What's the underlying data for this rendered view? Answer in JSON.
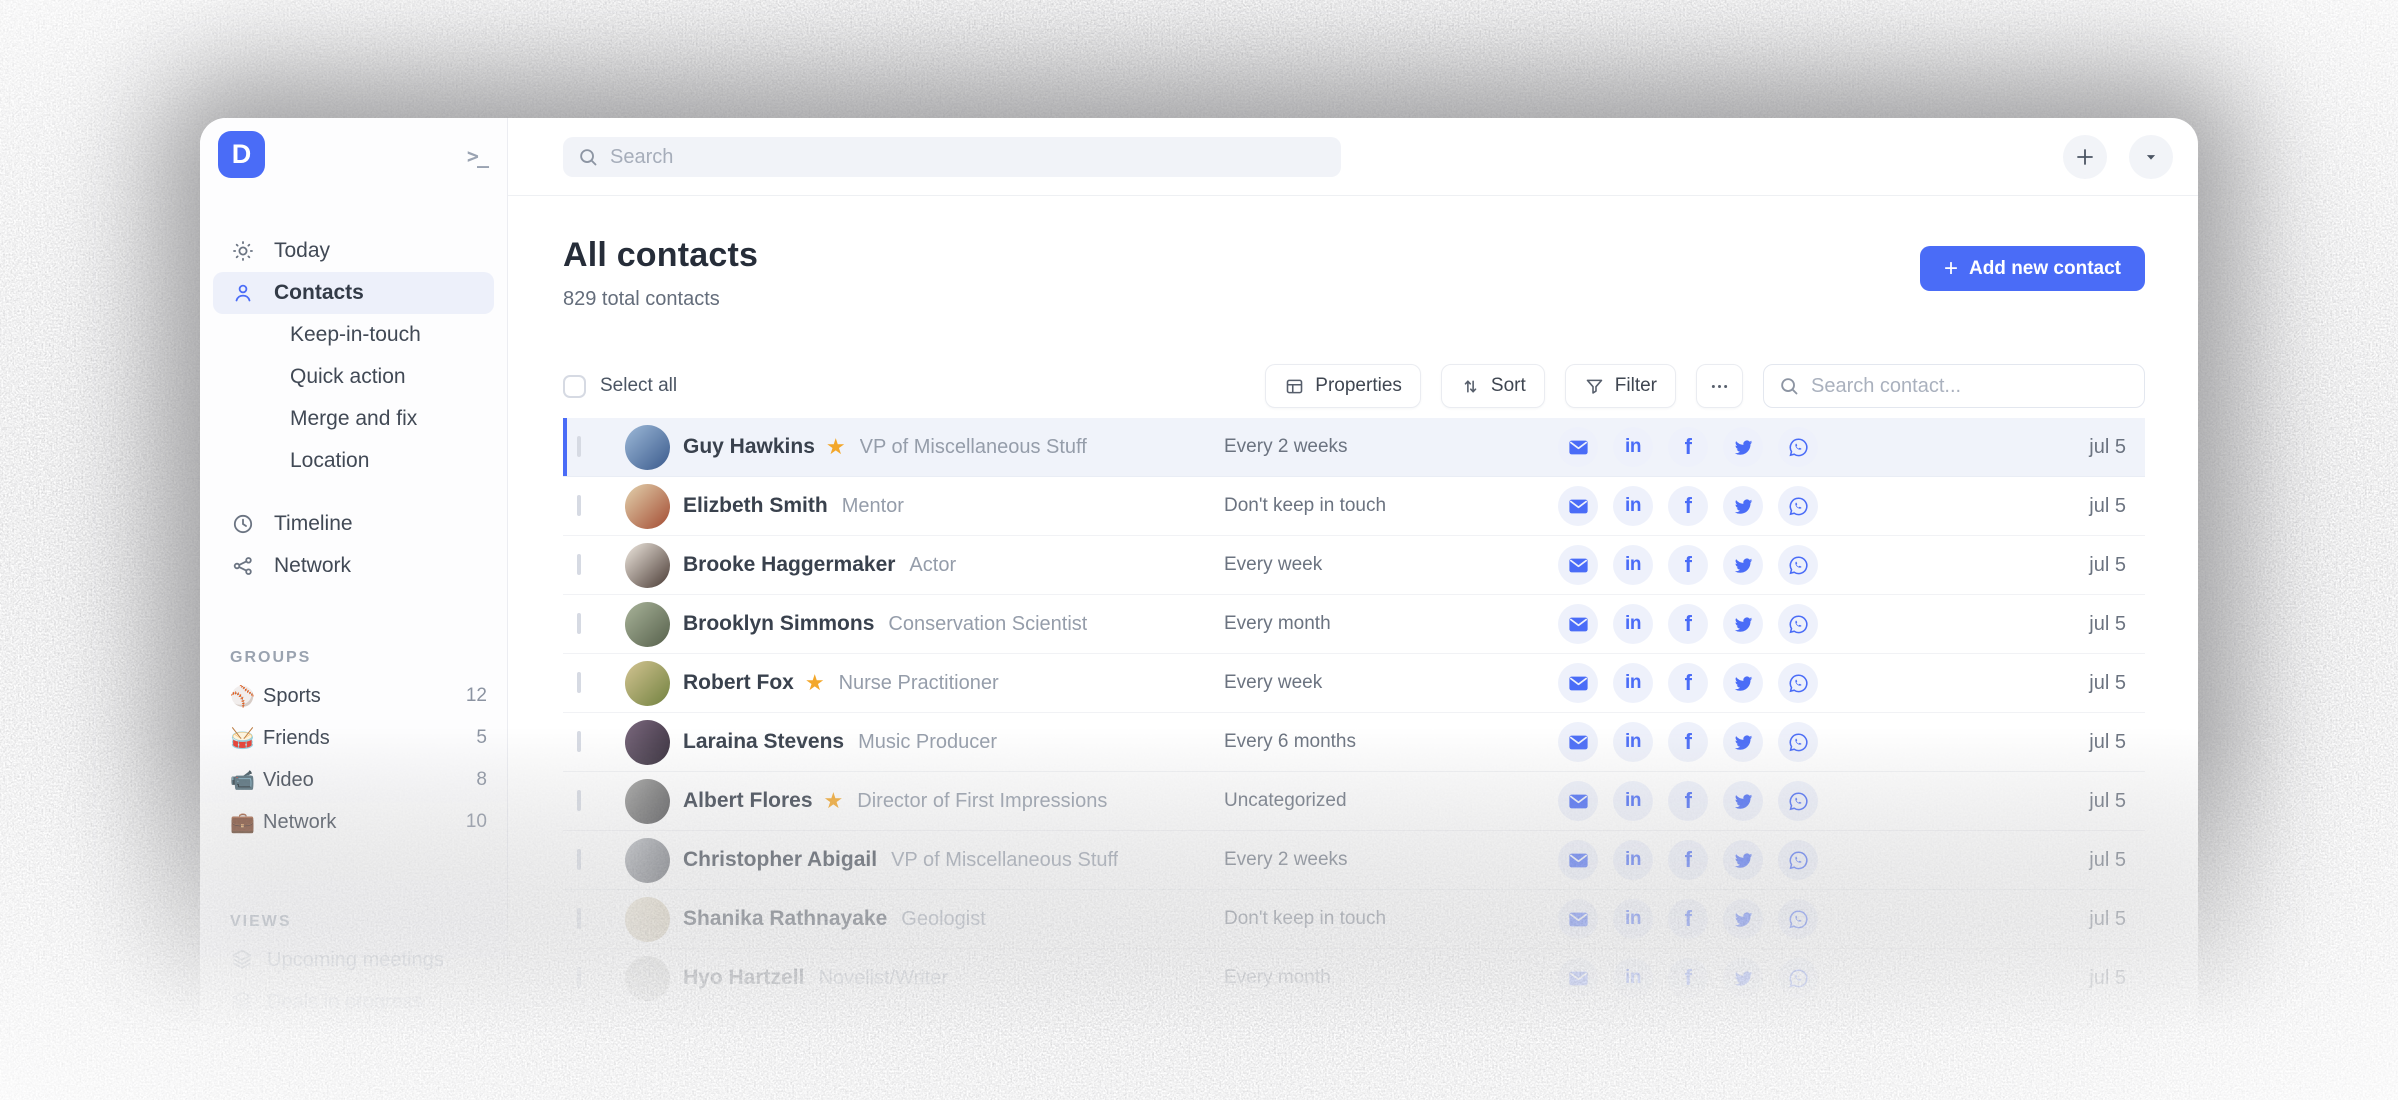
{
  "app": {
    "logo_letter": "D",
    "accent_color": "#4a6cf7",
    "star_color": "#f3a72a",
    "collapse_glyph": ">_"
  },
  "topbar": {
    "search_placeholder": "Search",
    "plus_label": "+",
    "caret_label": "▾"
  },
  "sidebar": {
    "nav": [
      {
        "label": "Today",
        "icon": "sun"
      },
      {
        "label": "Contacts",
        "icon": "person",
        "active": true
      },
      {
        "label": "Keep-in-touch",
        "sub": true
      },
      {
        "label": "Quick action",
        "sub": true
      },
      {
        "label": "Merge and fix",
        "sub": true
      },
      {
        "label": "Location",
        "sub": true
      },
      {
        "label": "Timeline",
        "icon": "clock",
        "gap_before": true
      },
      {
        "label": "Network",
        "icon": "share"
      }
    ],
    "groups": {
      "heading": "GROUPS",
      "items": [
        {
          "emoji": "⚾",
          "label": "Sports",
          "count": "12"
        },
        {
          "emoji": "🥁",
          "label": "Friends",
          "count": "5"
        },
        {
          "emoji": "📹",
          "label": "Video",
          "count": "8"
        },
        {
          "emoji": "💼",
          "label": "Network",
          "count": "10"
        }
      ]
    },
    "views": {
      "heading": "VIEWS",
      "items": [
        {
          "label": "Upcoming meetings"
        },
        {
          "label": "Deals in progress"
        }
      ]
    }
  },
  "header": {
    "title": "All contacts",
    "subtitle": "829 total contacts",
    "add_button": "Add new contact"
  },
  "toolbar": {
    "select_all": "Select all",
    "properties": "Properties",
    "sort": "Sort",
    "filter": "Filter",
    "more": "•••",
    "search_placeholder": "Search contact..."
  },
  "social_icons": [
    "email",
    "linkedin",
    "facebook",
    "twitter",
    "whatsapp"
  ],
  "contacts": [
    {
      "name": "Guy Hawkins",
      "starred": true,
      "title": "VP of Miscellaneous Stuff",
      "frequency": "Every 2 weeks",
      "date": "jul 5",
      "highlighted": true,
      "avatar": [
        "#9db9d8",
        "#3a5a8c"
      ]
    },
    {
      "name": "Elizbeth Smith",
      "starred": false,
      "title": "Mentor",
      "frequency": "Don't keep in touch",
      "date": "jul 5",
      "avatar": [
        "#e3d2ae",
        "#a34b32"
      ]
    },
    {
      "name": "Brooke Haggermaker",
      "starred": false,
      "title": "Actor",
      "frequency": "Every week",
      "date": "jul 5",
      "avatar": [
        "#efe8df",
        "#4a3b35"
      ]
    },
    {
      "name": "Brooklyn Simmons",
      "starred": false,
      "title": "Conservation Scientist",
      "frequency": "Every month",
      "date": "jul 5",
      "avatar": [
        "#a9b49a",
        "#56604b"
      ]
    },
    {
      "name": "Robert Fox",
      "starred": true,
      "title": "Nurse Practitioner",
      "frequency": "Every week",
      "date": "jul 5",
      "avatar": [
        "#d3c492",
        "#71813f"
      ]
    },
    {
      "name": "Laraina Stevens",
      "starred": false,
      "title": "Music Producer",
      "frequency": "Every 6 months",
      "date": "jul 5",
      "avatar": [
        "#7d6a80",
        "#2e2633"
      ]
    },
    {
      "name": "Albert Flores",
      "starred": true,
      "title": "Director of First Impressions",
      "frequency": "Uncategorized",
      "date": "jul 5",
      "avatar": [
        "#a8a8a6",
        "#48484a"
      ]
    },
    {
      "name": "Christopher Abigail",
      "starred": false,
      "title": "VP of Miscellaneous Stuff",
      "frequency": "Every 2 weeks",
      "date": "jul 5",
      "avatar": [
        "#bcbfc4",
        "#565960"
      ]
    },
    {
      "name": "Shanika Rathnayake",
      "starred": false,
      "title": "Geologist",
      "frequency": "Don't keep in touch",
      "date": "jul 5",
      "avatar": [
        "#ece5d4",
        "#c8bca2"
      ]
    },
    {
      "name": "Hyo Hartzell",
      "starred": false,
      "title": "Novelist/Writer",
      "frequency": "Every month",
      "date": "jul 5",
      "avatar": [
        "#dcdcda",
        "#bdbdb9"
      ]
    }
  ]
}
